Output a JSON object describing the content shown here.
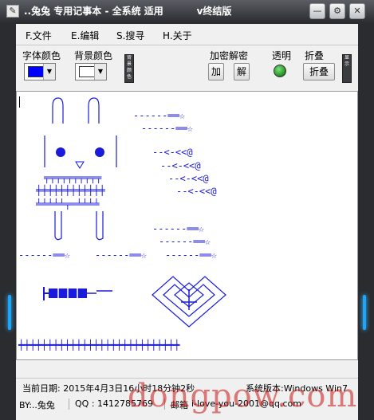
{
  "window": {
    "title": "..兔兔 专用记事本 - 全系统 适用          v终结版",
    "icon": "notepad-app-icon",
    "controls": [
      "minimize-icon",
      "settings-icon",
      "close-icon"
    ]
  },
  "menu": [
    {
      "label": "F.文件"
    },
    {
      "label": "E.编辑"
    },
    {
      "label": "S.搜寻"
    },
    {
      "label": "H.关于"
    }
  ],
  "toolbar": {
    "font_color_label": "字体颜色",
    "font_color_value": "#0000ff",
    "bg_color_label": "背景颜色",
    "bg_color_value": "#ffffff",
    "side_button_1": "背景颜色",
    "encrypt_label": "加密解密",
    "encrypt_button": "加",
    "decrypt_button": "解",
    "transparent_label": "透明",
    "fold_label": "折叠",
    "fold_button": "折叠",
    "side_button_2": "显示"
  },
  "status": {
    "date": "当前日期: 2015年4月3日16小时18分钟2秒",
    "system": "系统版本:Windows Win7",
    "author": "BY:..兔兔",
    "qq": "QQ : 1412785769",
    "email_label": "邮箱",
    "email": "i-love-you-2001@qq.com"
  },
  "watermark": "dongpow.com",
  "colors": {
    "chrome_dark": "#2a2c30",
    "accent_blue": "#19a6ff",
    "art_blue": "#1a1adb",
    "indicator_green": "#2a9a2a"
  }
}
